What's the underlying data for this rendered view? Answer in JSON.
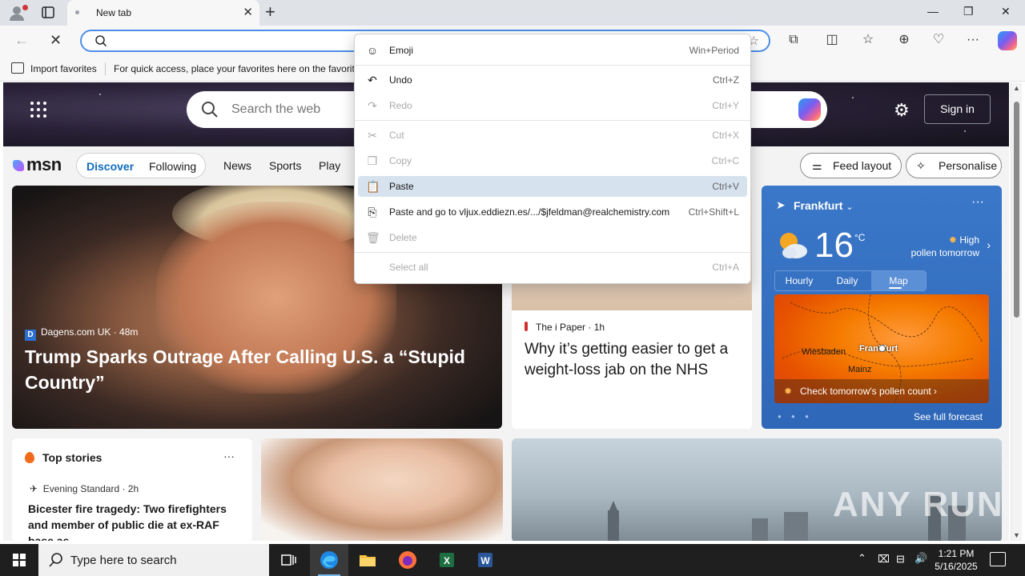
{
  "window": {
    "tab_title": "New tab",
    "tab_close": "✕",
    "new_tab": "+",
    "minimize": "—",
    "maximize": "❐",
    "close": "✕"
  },
  "toolbar": {
    "address_value": "",
    "favorites_import": "Import favorites",
    "favorites_hint": "For quick access, place your favorites here on the favorites bar."
  },
  "msn": {
    "search_placeholder": "Search the web",
    "signin": "Sign in",
    "logo": "msn",
    "segments": [
      "Discover",
      "Following"
    ],
    "nav": [
      "News",
      "Sports",
      "Play"
    ],
    "feed_layout": "Feed layout",
    "personalise": "Personalise"
  },
  "hero": {
    "source": "Dagens.com UK",
    "source_icon": "D",
    "age": "· 48m",
    "title": "Trump Sparks Outrage After Calling U.S. a “Stupid Country”"
  },
  "mid_story": {
    "source": "The i Paper",
    "age": "· 1h",
    "title": "Why it’s getting easier to get a weight-loss jab on the NHS"
  },
  "weather": {
    "location": "Frankfurt",
    "temp": "16",
    "unit": "°C",
    "pollen_line1": "High",
    "pollen_line2": "pollen tomorrow",
    "tabs": [
      "Hourly",
      "Daily",
      "Map"
    ],
    "active_tab": "Map",
    "map_cities": [
      "Wiesbaden",
      "Frankfurt",
      "Mainz"
    ],
    "map_footer": "Check tomorrow's pollen count",
    "see_full": "See full forecast",
    "more": "···"
  },
  "top_stories": {
    "heading": "Top stories",
    "more": "···",
    "source": "Evening Standard · 2h",
    "title": "Bicester fire tragedy: Two firefighters and member of public die at ex-RAF base as..."
  },
  "watermark": "ANY RUN",
  "context_menu": {
    "items": [
      {
        "label": "Emoji",
        "shortcut": "Win+Period",
        "icon": "emoji-icon",
        "enabled": true
      },
      {
        "label": "Undo",
        "shortcut": "Ctrl+Z",
        "icon": "undo-icon",
        "enabled": true
      },
      {
        "label": "Redo",
        "shortcut": "Ctrl+Y",
        "icon": "redo-icon",
        "enabled": false
      },
      {
        "label": "Cut",
        "shortcut": "Ctrl+X",
        "icon": "cut-icon",
        "enabled": false
      },
      {
        "label": "Copy",
        "shortcut": "Ctrl+C",
        "icon": "copy-icon",
        "enabled": false
      },
      {
        "label": "Paste",
        "shortcut": "Ctrl+V",
        "icon": "paste-icon",
        "enabled": true,
        "highlighted": true
      },
      {
        "label": "Paste and go to vljux.eddiezn.es/.../$jfeldman@realchemistry.com",
        "shortcut": "Ctrl+Shift+L",
        "icon": "paste-go-icon",
        "enabled": true
      },
      {
        "label": "Delete",
        "shortcut": "",
        "icon": "delete-icon",
        "enabled": false
      },
      {
        "label": "Select all",
        "shortcut": "Ctrl+A",
        "icon": "",
        "enabled": false
      }
    ]
  },
  "taskbar": {
    "search_placeholder": "Type here to search",
    "time": "1:21 PM",
    "date": "5/16/2025",
    "apps": [
      "task-view",
      "edge",
      "file-explorer",
      "firefox",
      "excel",
      "word"
    ]
  }
}
